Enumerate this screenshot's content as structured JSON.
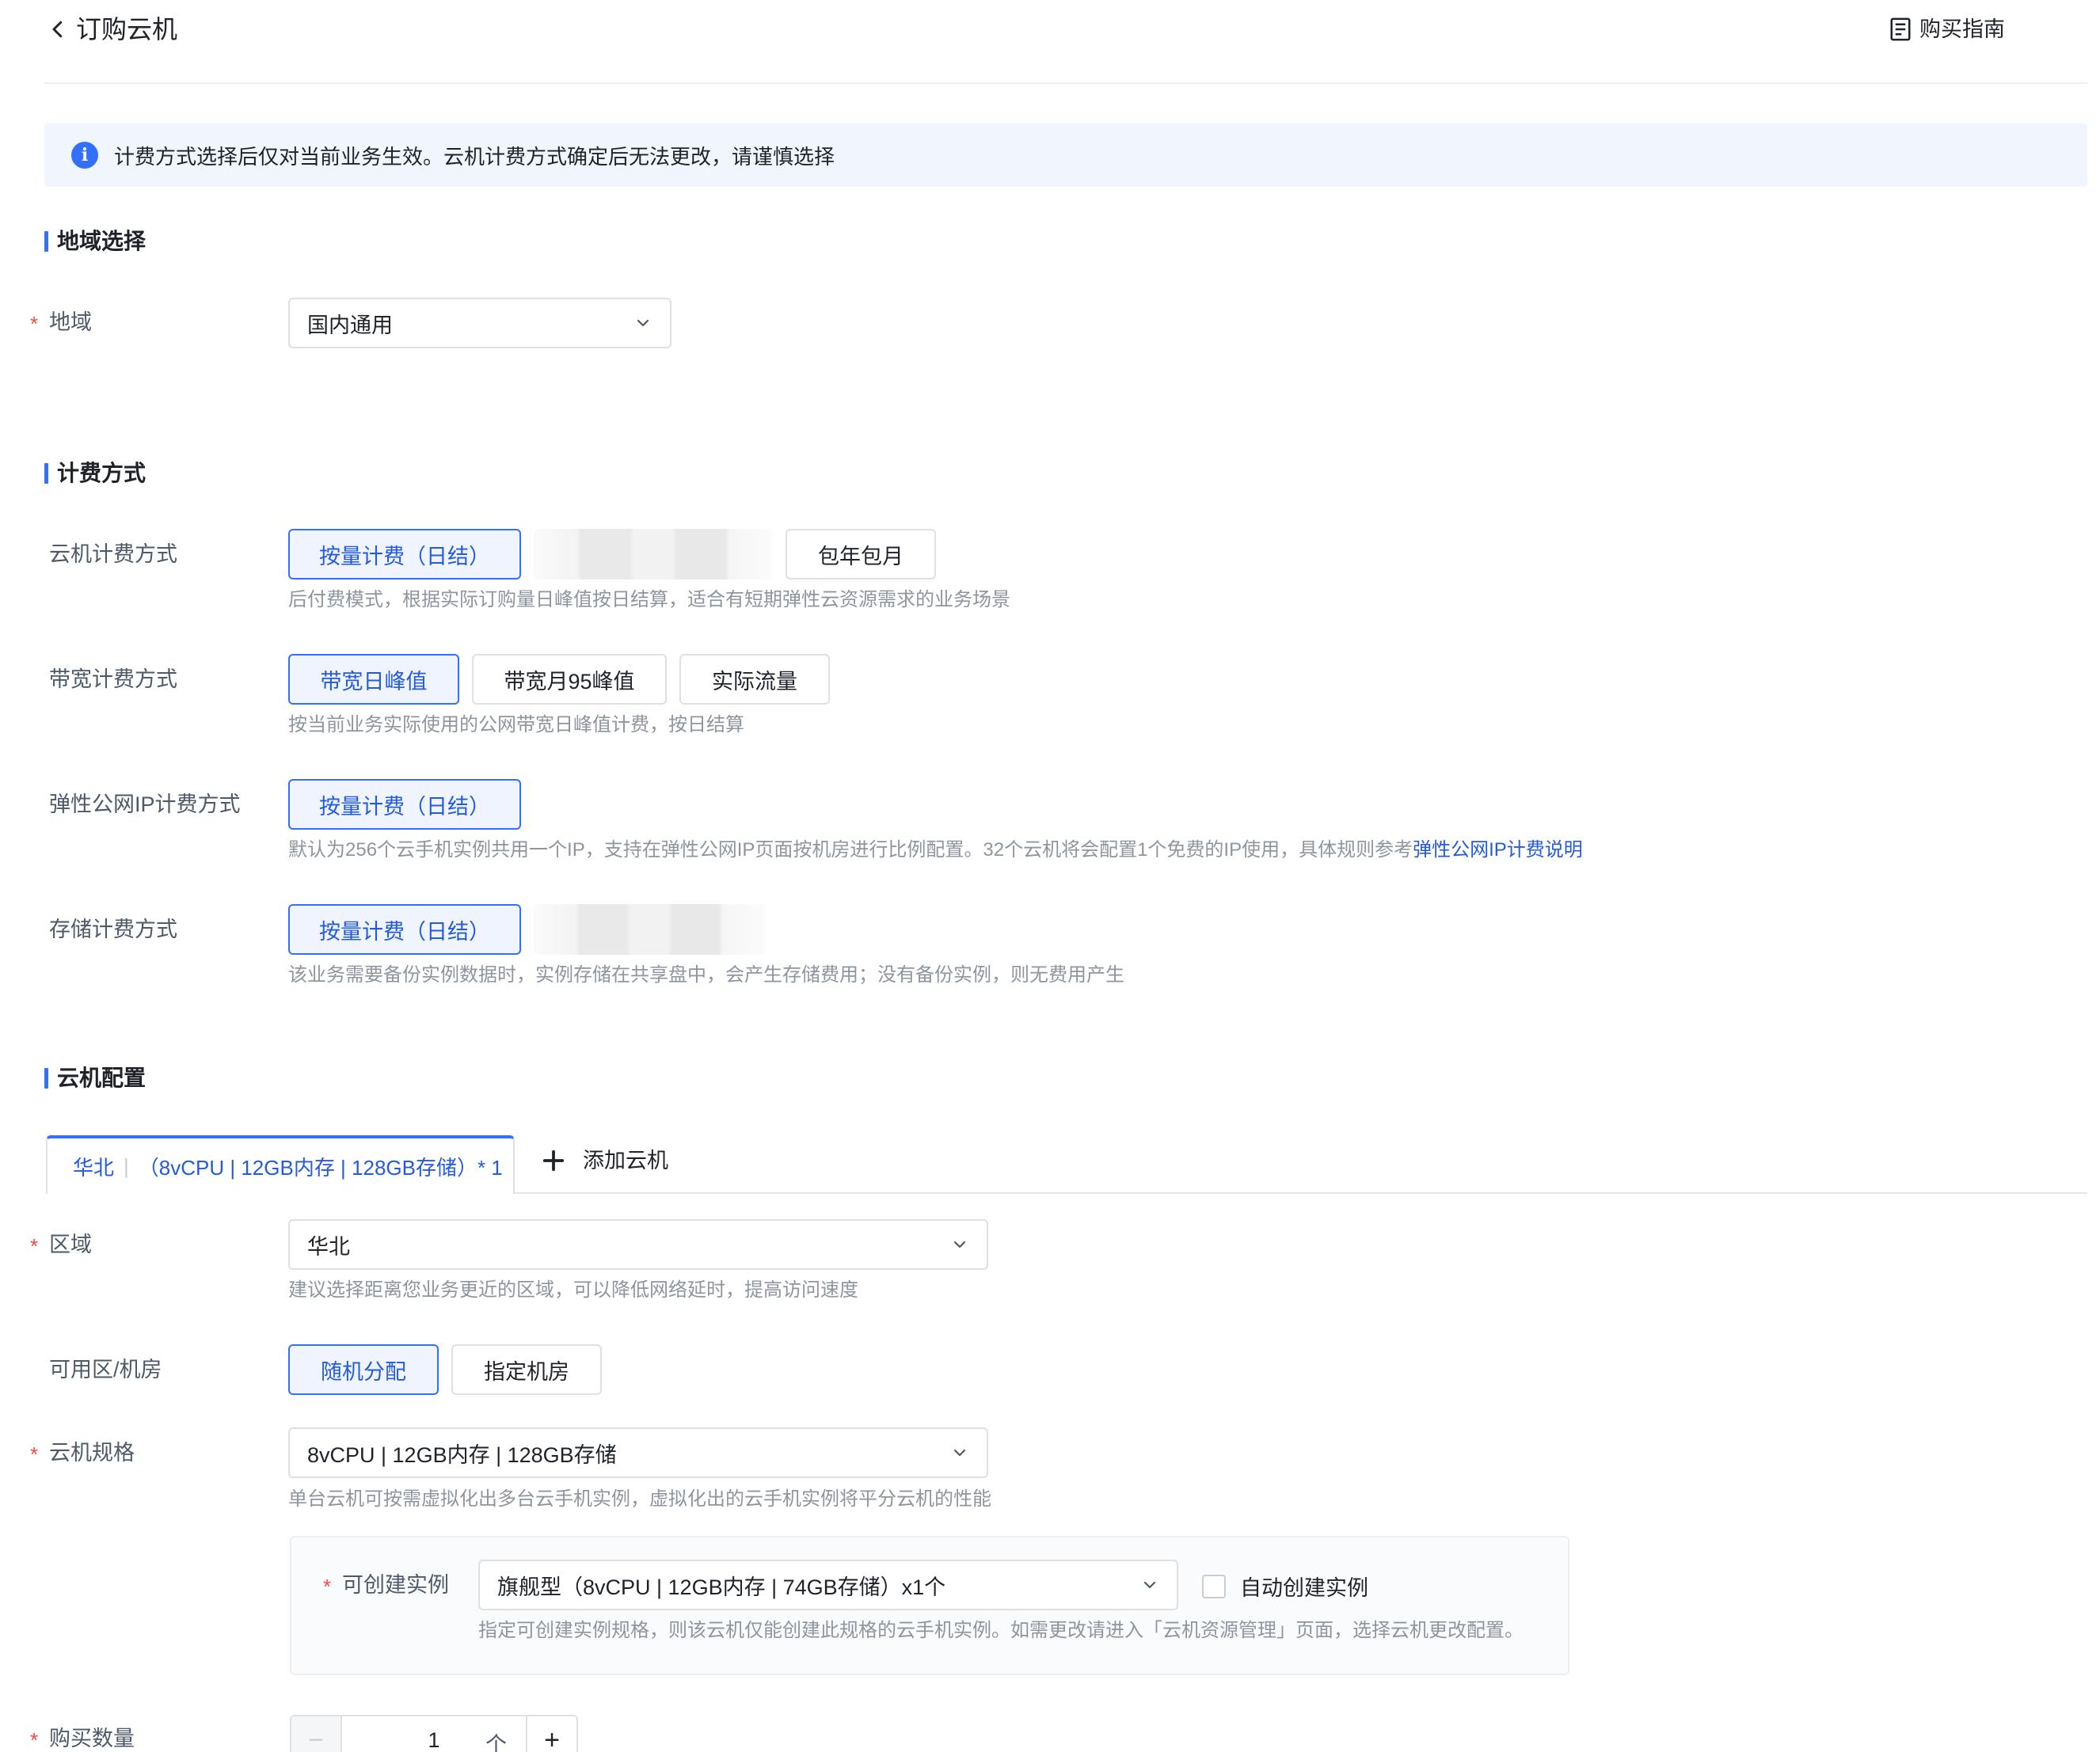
{
  "header": {
    "title": "订购云机",
    "guide_label": "购买指南"
  },
  "notice": {
    "text": "计费方式选择后仅对当前业务生效。云机计费方式确定后无法更改，请谨慎选择"
  },
  "region_section": {
    "title": "地域选择",
    "region_label": "地域",
    "region_value": "国内通用"
  },
  "billing_section": {
    "title": "计费方式",
    "cloud": {
      "label": "云机计费方式",
      "options": [
        "按量计费（日结）",
        "包年包月"
      ],
      "hint": "后付费模式，根据实际订购量日峰值按日结算，适合有短期弹性云资源需求的业务场景"
    },
    "bandwidth": {
      "label": "带宽计费方式",
      "options": [
        "带宽日峰值",
        "带宽月95峰值",
        "实际流量"
      ],
      "hint": "按当前业务实际使用的公网带宽日峰值计费，按日结算"
    },
    "eip": {
      "label": "弹性公网IP计费方式",
      "options": [
        "按量计费（日结）"
      ],
      "hint": "默认为256个云手机实例共用一个IP，支持在弹性公网IP页面按机房进行比例配置。32个云机将会配置1个免费的IP使用，具体规则参考",
      "hint_link": "弹性公网IP计费说明"
    },
    "storage": {
      "label": "存储计费方式",
      "options": [
        "按量计费（日结）"
      ],
      "hint": "该业务需要备份实例数据时，实例存储在共享盘中，会产生存储费用；没有备份实例，则无费用产生"
    }
  },
  "config_section": {
    "title": "云机配置",
    "tab": {
      "region": "华北",
      "sep": "|",
      "spec": "（8vCPU | 12GB内存 | 128GB存储）* 1"
    },
    "add_tab_label": "添加云机",
    "zone": {
      "label": "区域",
      "value": "华北",
      "hint": "建议选择距离您业务更近的区域，可以降低网络延时，提高访问速度"
    },
    "az": {
      "label": "可用区/机房",
      "options": [
        "随机分配",
        "指定机房"
      ]
    },
    "spec": {
      "label": "云机规格",
      "value": "8vCPU | 12GB内存 | 128GB存储",
      "hint": "单台云机可按需虚拟化出多台云手机实例，虚拟化出的云手机实例将平分云机的性能"
    },
    "instance": {
      "label": "可创建实例",
      "value": "旗舰型（8vCPU | 12GB内存 | 74GB存储）x1个",
      "auto_label": "自动创建实例",
      "hint": "指定可创建实例规格，则该云机仅能创建此规格的云手机实例。如需更改请进入「云机资源管理」页面，选择云机更改配置。"
    },
    "quantity": {
      "label": "购买数量",
      "value": "1",
      "unit": "个",
      "minus": "−",
      "plus": "+"
    }
  }
}
